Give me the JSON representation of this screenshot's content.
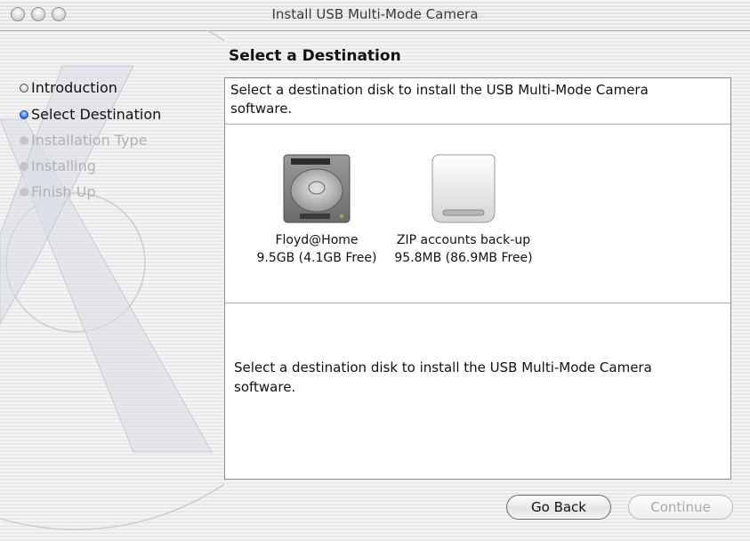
{
  "window": {
    "title": "Install USB Multi-Mode Camera",
    "controls": [
      "close-button",
      "minimize-button",
      "zoom-button"
    ]
  },
  "sidebar": {
    "steps": [
      {
        "label": "Introduction",
        "state": "done"
      },
      {
        "label": "Select Destination",
        "state": "current"
      },
      {
        "label": "Installation Type",
        "state": "pending"
      },
      {
        "label": "Installing",
        "state": "pending"
      },
      {
        "label": "Finish Up",
        "state": "pending"
      }
    ]
  },
  "main": {
    "heading": "Select a Destination",
    "instruction": "Select a destination disk to install the USB Multi-Mode Camera software.",
    "disks": [
      {
        "name": "Floyd@Home",
        "size": "9.5GB (4.1GB Free)",
        "icon": "hard-drive-icon"
      },
      {
        "name": "ZIP accounts back-up",
        "size": "95.8MB (86.9MB Free)",
        "icon": "zip-disk-icon"
      }
    ],
    "description": "Select a destination disk to install the USB Multi-Mode Camera software."
  },
  "buttons": {
    "back_label": "Go Back",
    "continue_label": "Continue"
  }
}
